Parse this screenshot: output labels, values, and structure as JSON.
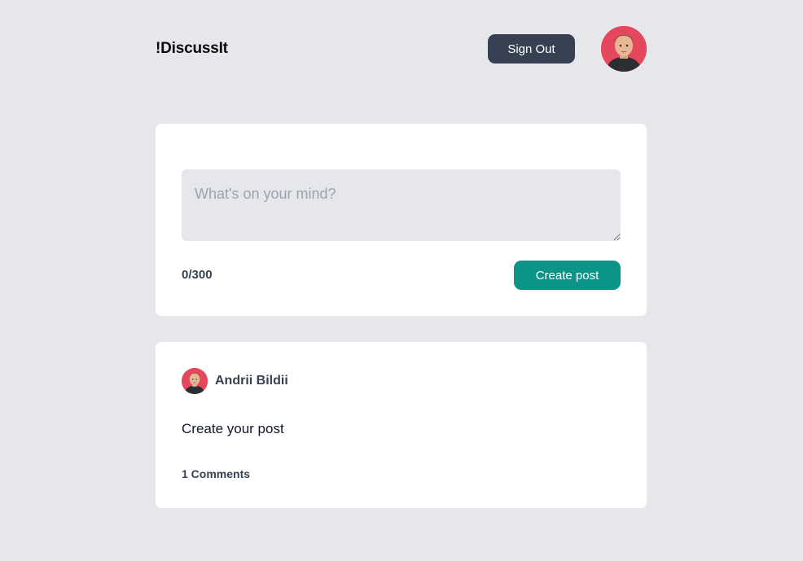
{
  "header": {
    "logo": "!DiscussIt",
    "sign_out_label": "Sign Out"
  },
  "composer": {
    "placeholder": "What's on your mind?",
    "value": "",
    "counter": "0/300",
    "create_label": "Create post"
  },
  "post": {
    "author": "Andrii Bildii",
    "body": "Create your post",
    "comments": "1 Comments"
  },
  "colors": {
    "background": "#e5e7eb",
    "card": "#ffffff",
    "sign_out_button": "#374151",
    "create_button": "#0d9488",
    "avatar_bg": "#e5485d"
  }
}
